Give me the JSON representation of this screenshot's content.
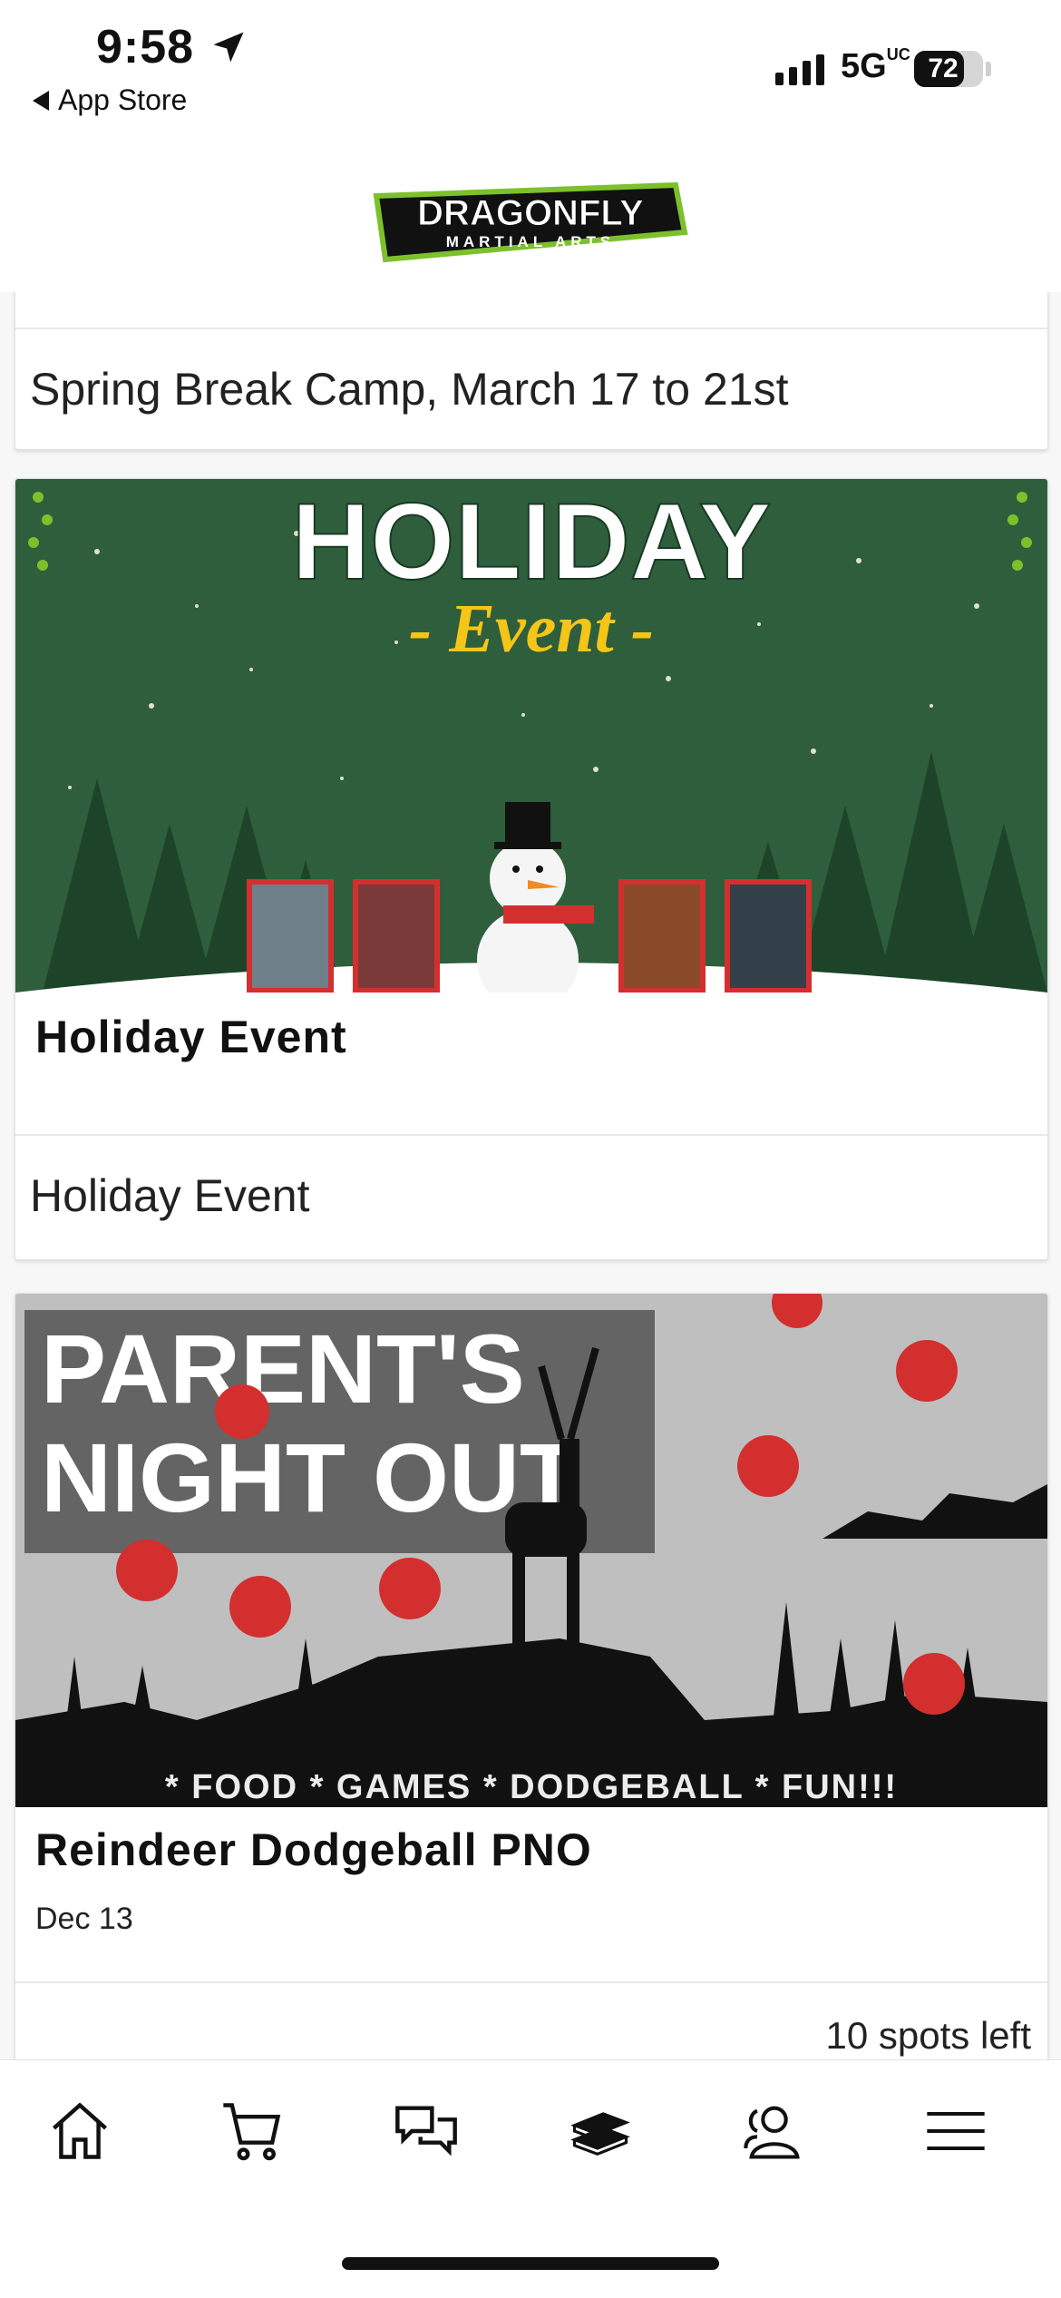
{
  "status_bar": {
    "time": "9:58",
    "back_label": "App Store",
    "network": "5G",
    "network_suffix": "UC",
    "battery_percent": 72
  },
  "header": {
    "logo_text_top": "DRAGONFLY",
    "logo_text_bottom": "MARTIAL ARTS",
    "logo_icon": "dragonfly-logo"
  },
  "events": [
    {
      "description": "Spring Break Camp, March 17 to 21st"
    },
    {
      "banner": {
        "headline": "HOLIDAY",
        "subheadline": "- Event -",
        "colors": {
          "bg": "#2e5e3c",
          "accent": "#f5c518"
        }
      },
      "title": "Holiday Event",
      "date": "",
      "description": "Holiday Event"
    },
    {
      "banner": {
        "headline_line1": "PARENT'S",
        "headline_line2": "NIGHT OUT",
        "footer": "* FOOD * GAMES * DODGEBALL * FUN!!!",
        "colors": {
          "bg": "#bfbfbf",
          "ball": "#d32f2f"
        }
      },
      "title": "Reindeer Dodgeball PNO",
      "date": "Dec 13",
      "spots": "10 spots left"
    }
  ],
  "tabbar": {
    "items": [
      {
        "icon": "home-icon"
      },
      {
        "icon": "cart-icon"
      },
      {
        "icon": "chat-icon"
      },
      {
        "icon": "books-icon"
      },
      {
        "icon": "users-icon"
      },
      {
        "icon": "menu-icon"
      }
    ]
  }
}
